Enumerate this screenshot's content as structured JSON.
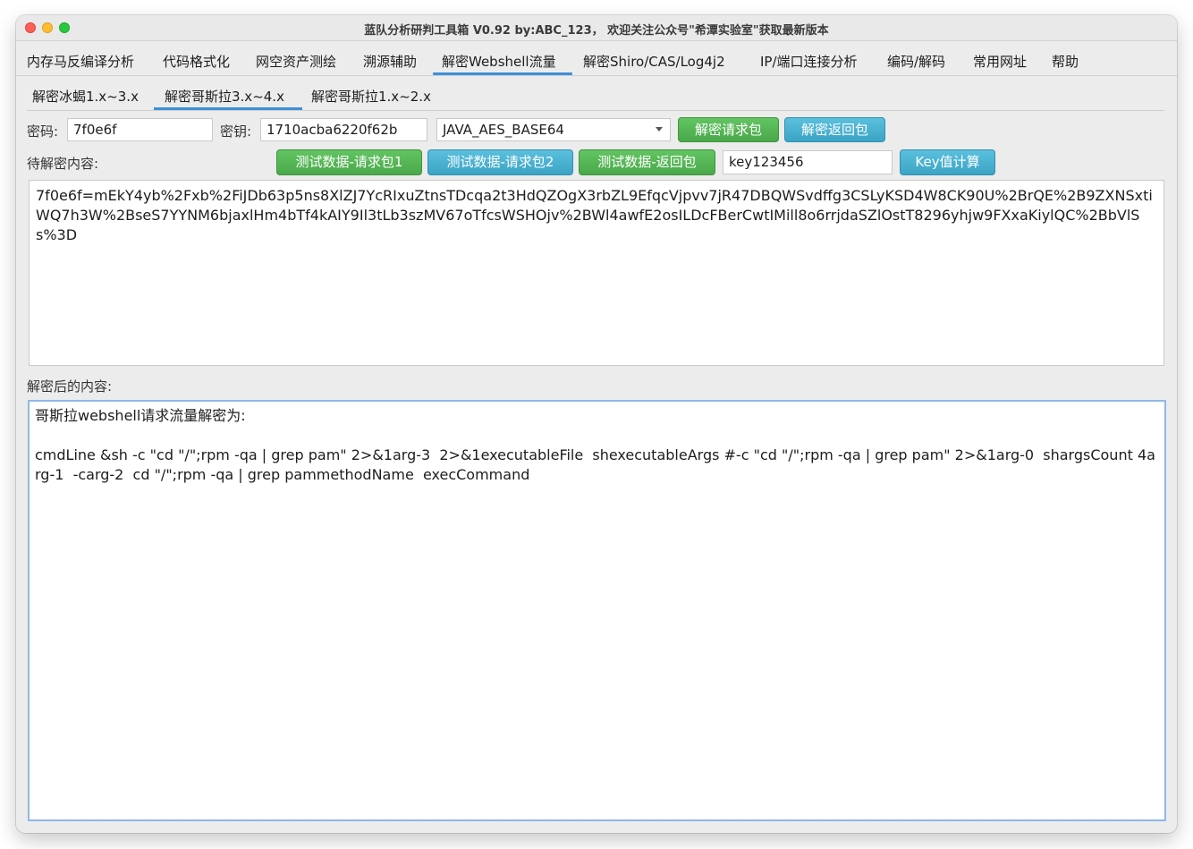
{
  "window": {
    "title": "蓝队分析研判工具箱 V0.92 by:ABC_123， 欢迎关注公众号\"希潭实验室\"获取最新版本"
  },
  "menu": {
    "tabs": [
      {
        "label": "内存马反编译分析"
      },
      {
        "label": "代码格式化"
      },
      {
        "label": "网空资产测绘"
      },
      {
        "label": "溯源辅助"
      },
      {
        "label": "解密Webshell流量"
      },
      {
        "label": "解密Shiro/CAS/Log4j2"
      },
      {
        "label": "IP/端口连接分析"
      },
      {
        "label": "编码/解码"
      },
      {
        "label": "常用网址"
      },
      {
        "label": "帮助"
      }
    ],
    "active_index": 4
  },
  "subtabs": {
    "tabs": [
      {
        "label": "解密冰蝎1.x~3.x"
      },
      {
        "label": "解密哥斯拉3.x~4.x"
      },
      {
        "label": "解密哥斯拉1.x~2.x"
      }
    ],
    "active_index": 1
  },
  "form": {
    "password_label": "密码:",
    "password_value": "7f0e6f",
    "key_label": "密钥:",
    "key_value": "1710acba6220f62b",
    "mode_selected": "JAVA_AES_BASE64",
    "decrypt_request_button": "解密请求包",
    "decrypt_response_button": "解密返回包",
    "pending_label": "待解密内容:",
    "test_request1_button": "测试数据-请求包1",
    "test_request2_button": "测试数据-请求包2",
    "test_response_button": "测试数据-返回包",
    "key_calc_input": "key123456",
    "key_calc_button": "Key值计算",
    "input_text": "7f0e6f=mEkY4yb%2Fxb%2FiJDb63p5ns8XlZJ7YcRIxuZtnsTDcqa2t3HdQZOgX3rbZL9EfqcVjpvv7jR47DBQWSvdffg3CSLyKSD4W8CK90U%2BrQE%2B9ZXNSxtiWQ7h3W%2BseS7YYNM6bjaxlHm4bTf4kAIY9Il3tLb3szMV67oTfcsWSHOjv%2BWl4awfE2osILDcFBerCwtIMill8o6rrjdaSZlOstT8296yhjw9FXxaKiylQC%2BbVlSs%3D",
    "output_label": "解密后的内容:",
    "output_line1": "哥斯拉webshell请求流量解密为:",
    "output_line2": "",
    "output_line3": "cmdLine &sh -c \"cd \"/\";rpm -qa | grep pam\" 2>&1arg-3  2>&1executableFile  shexecutableArgs #-c \"cd \"/\";rpm -qa | grep pam\" 2>&1arg-0  shargsCount 4arg-1  -carg-2  cd \"/\";rpm -qa | grep pammethodName  execCommand"
  },
  "colors": {
    "tab_underline": "#3d8fd8",
    "green_button": "#4cae4c",
    "blue_button": "#46b8da"
  }
}
